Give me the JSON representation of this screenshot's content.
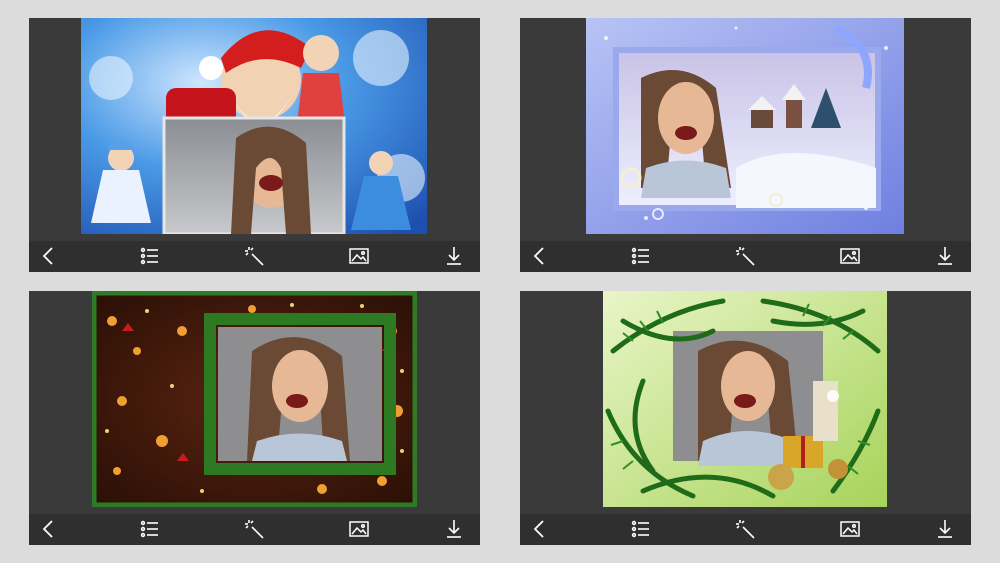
{
  "panels": [
    {
      "frame_theme": "santa-snow-maiden-frost",
      "accent": "#2f6fd0"
    },
    {
      "frame_theme": "blue-winter-village-ribbon",
      "accent": "#7f8fe0"
    },
    {
      "frame_theme": "christmas-lights-garland",
      "accent": "#2a6a22"
    },
    {
      "frame_theme": "pine-branches-gifts",
      "accent": "#3b8a2e"
    }
  ],
  "toolbar_icons": [
    "back-icon",
    "list-icon",
    "magic-wand-icon",
    "image-icon",
    "download-icon"
  ],
  "colors": {
    "background": "#dcdcdc",
    "panel": "#3a3a3a",
    "toolbar": "#2f2f2f",
    "icon": "#ffffff"
  }
}
